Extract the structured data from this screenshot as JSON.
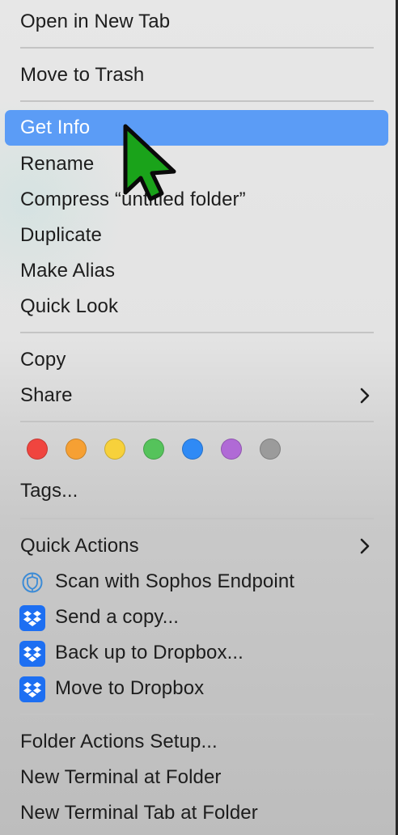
{
  "menu": {
    "open_in_new_tab": "Open in New Tab",
    "move_to_trash": "Move to Trash",
    "get_info": "Get Info",
    "rename": "Rename",
    "compress": "Compress “untitled folder”",
    "duplicate": "Duplicate",
    "make_alias": "Make Alias",
    "quick_look": "Quick Look",
    "copy": "Copy",
    "share": "Share",
    "tags": "Tags...",
    "quick_actions": "Quick Actions",
    "scan_sophos": "Scan with Sophos Endpoint",
    "send_copy": "Send a copy...",
    "back_up_dropbox": "Back up to Dropbox...",
    "move_to_dropbox": "Move to Dropbox",
    "folder_actions_setup": "Folder Actions Setup...",
    "new_terminal": "New Terminal at Folder",
    "new_terminal_tab": "New Terminal Tab at Folder"
  },
  "tag_colors": [
    "#f0453f",
    "#f6a033",
    "#f7d13b",
    "#55c35b",
    "#2f8af5",
    "#b06ad6",
    "#9b9b9b"
  ],
  "colors": {
    "highlight": "#5b9cf6",
    "dropbox": "#1d6ff2",
    "cursor": "#1aa31a"
  },
  "icons": {
    "share_submenu": "chevron-right-icon",
    "quick_actions_submenu": "chevron-right-icon",
    "sophos": "sophos-shield-icon",
    "dropbox": "dropbox-icon",
    "pointer": "cursor-arrow-icon"
  }
}
